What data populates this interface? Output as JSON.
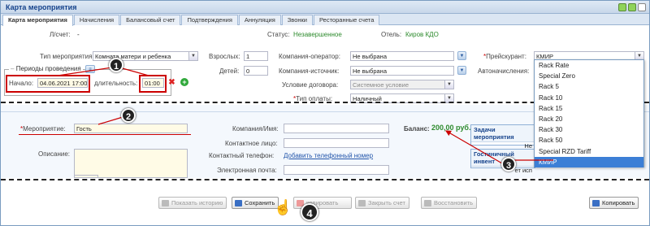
{
  "window": {
    "title": "Карта мероприятия"
  },
  "tabs": [
    {
      "label": "Карта мероприятия",
      "active": true
    },
    {
      "label": "Начисления"
    },
    {
      "label": "Балансовый счет"
    },
    {
      "label": "Подтверждения"
    },
    {
      "label": "Аннуляция"
    },
    {
      "label": "Звонки"
    },
    {
      "label": "Ресторанные счета"
    }
  ],
  "header": {
    "account_label": "Л/счет:",
    "account_value": "-",
    "status_label": "Статус:",
    "status_value": "Незавершенное",
    "hotel_label": "Отель:",
    "hotel_value": "Киров КДО"
  },
  "form": {
    "event_type_label": "Тип мероприятия:",
    "event_type_value": "Комната матери и ребенка",
    "adults_label": "Взрослых:",
    "adults_value": "1",
    "children_label": "Детей:",
    "children_value": "0",
    "operator_label": "Компания-оператор:",
    "operator_value": "Не выбрана",
    "source_label": "Компания-источник:",
    "source_value": "Не выбрана",
    "contract_label": "Условие договора:",
    "contract_value": "Системное условие",
    "payment_label": "Тип оплаты:",
    "payment_value": "Наличный",
    "pricelist_label": "Прейскурант:",
    "pricelist_value": "КМИР",
    "autocharge_label": "Автоначисления:",
    "periods_legend": "Периоды проведения",
    "start_label": "Начало:",
    "start_value": "04.06.2021 17:00",
    "duration_label": "длительность:",
    "duration_value": "01:00"
  },
  "event": {
    "event_label": "Мероприятие:",
    "event_value": "Гость",
    "description_label": "Описание:",
    "company_label": "Компания/Имя:",
    "contact_label": "Контактное лицо:",
    "phone_label": "Контактный телефон:",
    "phone_link": "Добавить телефонный номер",
    "email_label": "Электронная почта:",
    "balance_label": "Баланс:",
    "balance_value": "200,00 руб.",
    "tasks_title": "Задачи мероприятия",
    "tasks_partial": "Не",
    "guest_box_title": "Гостиничный инвент",
    "guest_box_partial": "ет исп"
  },
  "pricelist_options": [
    "Rack Rate",
    "Special Zero",
    "Rack 5",
    "Rack 10",
    "Rack 15",
    "Rack 20",
    "Rack 30",
    "Rack 50",
    "Special RZD Tariff",
    "КМИР"
  ],
  "pricelist_selected_index": 9,
  "footer": {
    "history_label": "Показать историю",
    "save_label": "Сохранить",
    "copy_partial_label": "копировать",
    "close_label": "Закрыть счет",
    "restore_label": "Восстановить",
    "copy_label": "Копировать"
  },
  "badges": [
    "1",
    "2",
    "3",
    "4"
  ],
  "colors": {
    "accent": "#15428b",
    "green": "#2e8b2e",
    "annotation_red": "#cc0000"
  }
}
